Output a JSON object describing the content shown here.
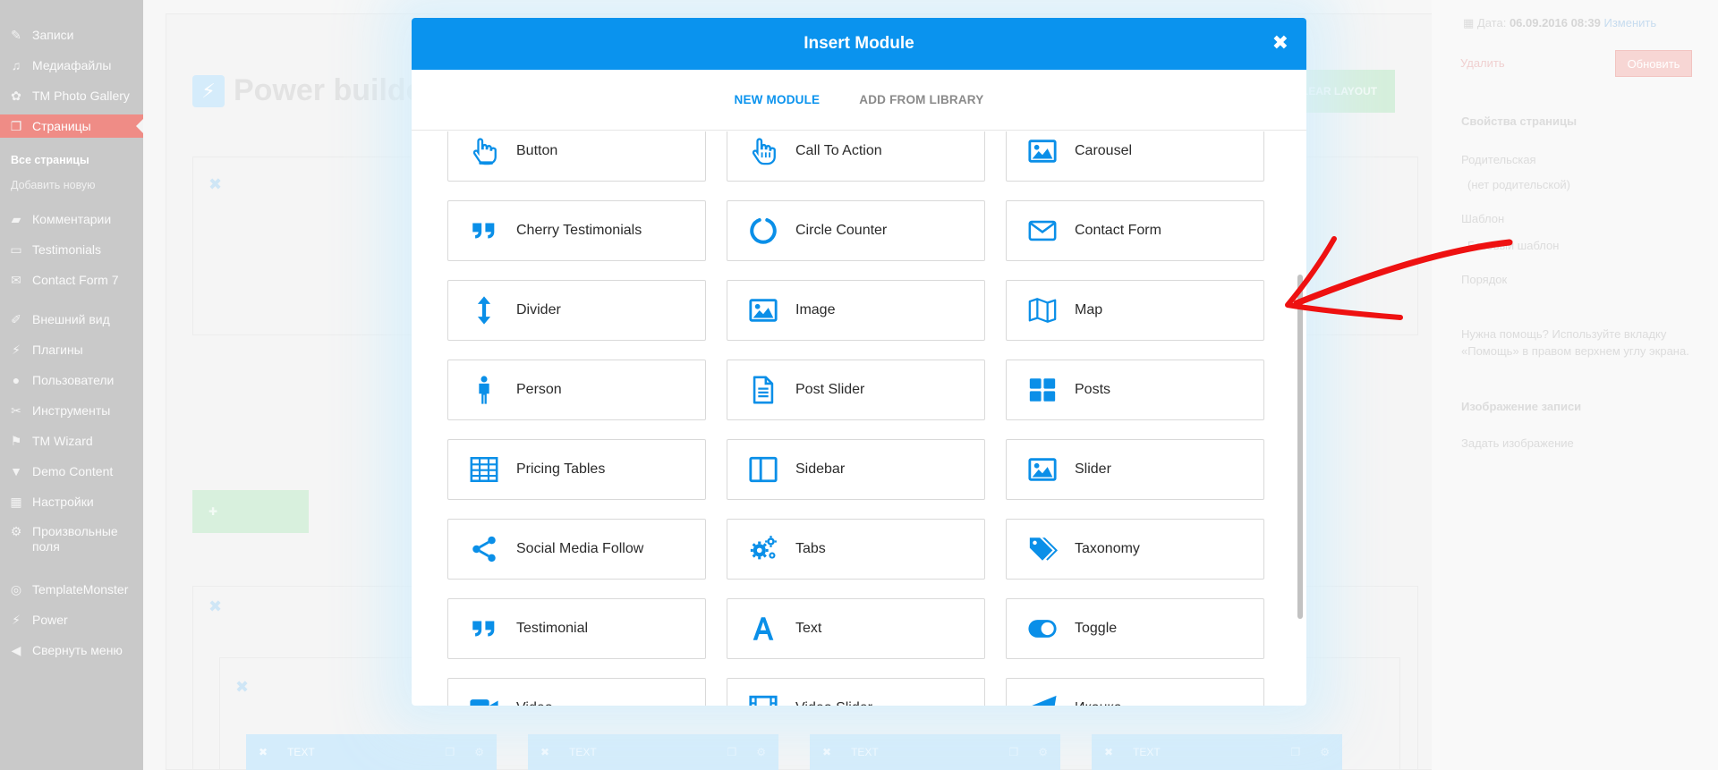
{
  "sidebar": {
    "items": [
      {
        "label": "Записи",
        "icon": "pin-icon"
      },
      {
        "label": "Медиафайлы",
        "icon": "media-icon"
      },
      {
        "label": "TM Photo Gallery",
        "icon": "gallery-icon"
      },
      {
        "label": "Страницы",
        "icon": "pages-icon"
      },
      {
        "label": "Комментарии",
        "icon": "comments-icon"
      },
      {
        "label": "Testimonials",
        "icon": "testimonials-icon"
      },
      {
        "label": "Contact Form 7",
        "icon": "mail-icon"
      },
      {
        "label": "Внешний вид",
        "icon": "brush-icon"
      },
      {
        "label": "Плагины",
        "icon": "plugin-icon"
      },
      {
        "label": "Пользователи",
        "icon": "user-icon"
      },
      {
        "label": "Инструменты",
        "icon": "wrench-icon"
      },
      {
        "label": "TM Wizard",
        "icon": "flag-icon"
      },
      {
        "label": "Demo Content",
        "icon": "demo-icon"
      },
      {
        "label": "Настройки",
        "icon": "settings-icon"
      },
      {
        "label": "Произвольные поля",
        "icon": "gear-icon"
      },
      {
        "label": "TemplateMonster",
        "icon": "tm-icon"
      },
      {
        "label": "Power",
        "icon": "power-icon"
      },
      {
        "label": "Свернуть меню",
        "icon": "collapse-icon"
      }
    ],
    "sub_items": [
      "Все страницы",
      "Добавить новую"
    ]
  },
  "editor": {
    "title": "Power builde",
    "clear_layout": "LEAR LAYOUT",
    "text_chip_label": "TEXT"
  },
  "meta": {
    "date_label": "Дата:",
    "date_value": "06.09.2016 08:39",
    "date_change": "Изменить",
    "delete": "Удалить",
    "update": "Обновить",
    "page_props": "Свойства страницы",
    "parent": "Родительская",
    "parent_value": "(нет родительской)",
    "template": "Шаблон",
    "template_value": "Базовый шаблон",
    "order": "Порядок",
    "help_line1": "Нужна помощь? Используйте вкладку",
    "help_line2": "«Помощь» в правом верхнем углу экрана.",
    "featured": "Изображение записи",
    "featured_link": "Задать изображение"
  },
  "modal": {
    "title": "Insert Module",
    "close": "✖",
    "tabs": [
      {
        "label": "NEW MODULE",
        "active": true
      },
      {
        "label": "ADD FROM LIBRARY",
        "active": false
      }
    ],
    "modules": [
      {
        "label": "Button",
        "icon": "pointer-hand-icon"
      },
      {
        "label": "Call To Action",
        "icon": "pointer-hand-outline-icon"
      },
      {
        "label": "Carousel",
        "icon": "image-icon"
      },
      {
        "label": "Cherry Testimonials",
        "icon": "quote-icon"
      },
      {
        "label": "Circle Counter",
        "icon": "circle-notch-icon"
      },
      {
        "label": "Contact Form",
        "icon": "envelope-icon"
      },
      {
        "label": "Divider",
        "icon": "vertical-arrows-icon"
      },
      {
        "label": "Image",
        "icon": "image-icon"
      },
      {
        "label": "Map",
        "icon": "map-icon"
      },
      {
        "label": "Person",
        "icon": "person-icon"
      },
      {
        "label": "Post Slider",
        "icon": "document-icon"
      },
      {
        "label": "Posts",
        "icon": "grid-icon"
      },
      {
        "label": "Pricing Tables",
        "icon": "table-icon"
      },
      {
        "label": "Sidebar",
        "icon": "sidebar-icon"
      },
      {
        "label": "Slider",
        "icon": "image-icon"
      },
      {
        "label": "Social Media Follow",
        "icon": "share-icon"
      },
      {
        "label": "Tabs",
        "icon": "gears-icon"
      },
      {
        "label": "Taxonomy",
        "icon": "tags-icon"
      },
      {
        "label": "Testimonial",
        "icon": "quote-icon"
      },
      {
        "label": "Text",
        "icon": "font-icon"
      },
      {
        "label": "Toggle",
        "icon": "toggle-icon"
      },
      {
        "label": "Video",
        "icon": "video-camera-icon"
      },
      {
        "label": "Video Slider",
        "icon": "film-icon"
      },
      {
        "label": "Иконка",
        "icon": "paper-plane-icon"
      }
    ]
  },
  "colors": {
    "accent": "#0a93ee",
    "icon": "#0a8fe8",
    "annotation_arrow": "#ee1111"
  }
}
